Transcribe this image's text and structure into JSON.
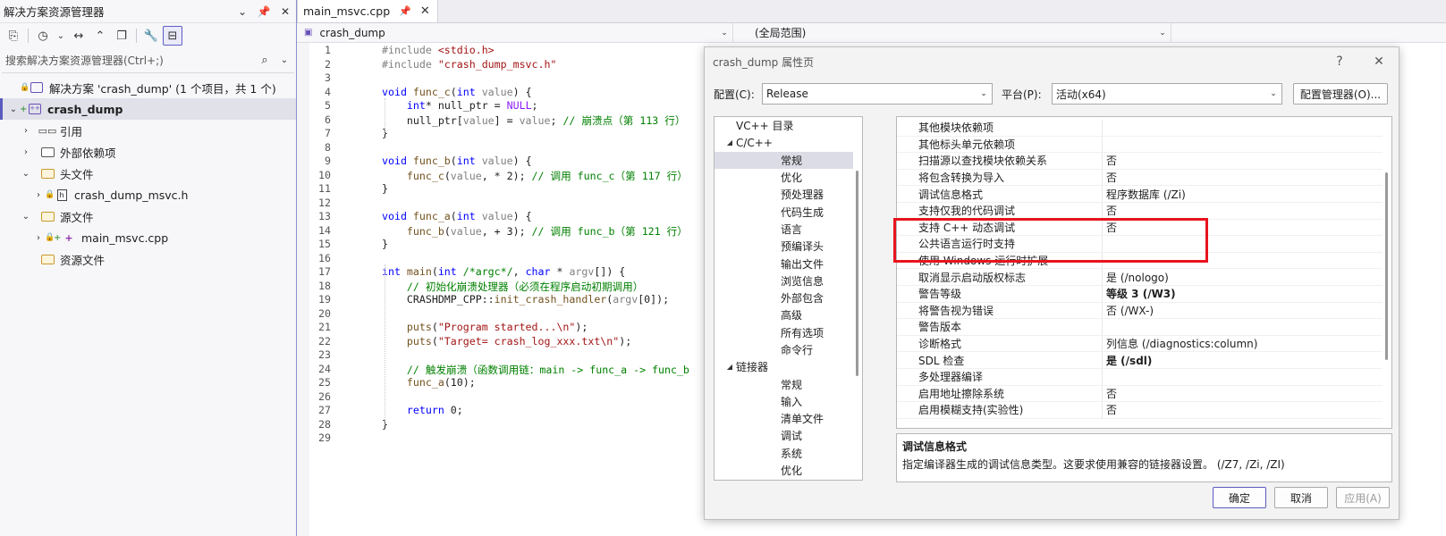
{
  "solution_explorer": {
    "title": "解决方案资源管理器",
    "search_placeholder": "搜索解决方案资源管理器(Ctrl+;)",
    "tree": [
      {
        "label": "解决方案 'crash_dump' (1 个项目，共 1 个)",
        "level": 0,
        "expand": "",
        "lock": true,
        "icon": "solution-icon"
      },
      {
        "label": "crash_dump",
        "level": 0,
        "expand": "open",
        "plus": true,
        "icon": "project-icon",
        "selected": true,
        "bold": true
      },
      {
        "label": "引用",
        "level": 1,
        "expand": "closed",
        "icon": "reference-icon"
      },
      {
        "label": "外部依赖项",
        "level": 1,
        "expand": "closed",
        "icon": "external-deps-icon"
      },
      {
        "label": "头文件",
        "level": 1,
        "expand": "open",
        "icon": "folder-icon"
      },
      {
        "label": "crash_dump_msvc.h",
        "level": 2,
        "expand": "closed",
        "lock": true,
        "icon": "header-file-icon"
      },
      {
        "label": "源文件",
        "level": 1,
        "expand": "open",
        "icon": "folder-icon"
      },
      {
        "label": "main_msvc.cpp",
        "level": 2,
        "expand": "closed",
        "lock": true,
        "plus": true,
        "icon": "cpp-file-icon"
      },
      {
        "label": "资源文件",
        "level": 1,
        "expand": "",
        "icon": "folder-icon"
      }
    ]
  },
  "editor": {
    "tab": "main_msvc.cpp",
    "nav_project": "crash_dump",
    "nav_scope": "(全局范围)",
    "code_lines": [
      [
        [
          "pp",
          "#include "
        ],
        [
          "str",
          "<stdio.h>"
        ]
      ],
      [
        [
          "pp",
          "#include "
        ],
        [
          "str",
          "\"crash_dump_msvc.h\""
        ]
      ],
      [],
      [
        [
          "kw",
          "void "
        ],
        [
          "fn",
          "func_c"
        ],
        [
          "",
          "("
        ],
        [
          "kw",
          "int "
        ],
        [
          "par",
          "value"
        ],
        [
          "",
          ") {"
        ]
      ],
      [
        [
          "",
          "    "
        ],
        [
          "kw",
          "int"
        ],
        [
          "",
          "* null_ptr = "
        ],
        [
          "mac",
          "NULL"
        ],
        [
          "",
          ";"
        ]
      ],
      [
        [
          "",
          "    null_ptr["
        ],
        [
          "par",
          "value"
        ],
        [
          "",
          "] = "
        ],
        [
          "par",
          "value"
        ],
        [
          "",
          "; "
        ],
        [
          "cm",
          "// 崩溃点（第 113 行）"
        ]
      ],
      [
        [
          "",
          "}"
        ]
      ],
      [],
      [
        [
          "kw",
          "void "
        ],
        [
          "fn",
          "func_b"
        ],
        [
          "",
          "("
        ],
        [
          "kw",
          "int "
        ],
        [
          "par",
          "value"
        ],
        [
          "",
          ") {"
        ]
      ],
      [
        [
          "",
          "    "
        ],
        [
          "fn",
          "func_c"
        ],
        [
          "",
          "("
        ],
        [
          "par",
          "value"
        ],
        [
          "",
          ", * 2); "
        ],
        [
          "cm",
          "// 调用 func_c（第 117 行）"
        ]
      ],
      [
        [
          "",
          "}"
        ]
      ],
      [],
      [
        [
          "kw",
          "void "
        ],
        [
          "fn",
          "func_a"
        ],
        [
          "",
          "("
        ],
        [
          "kw",
          "int "
        ],
        [
          "par",
          "value"
        ],
        [
          "",
          ") {"
        ]
      ],
      [
        [
          "",
          "    "
        ],
        [
          "fn",
          "func_b"
        ],
        [
          "",
          "("
        ],
        [
          "par",
          "value"
        ],
        [
          "",
          ", + 3); "
        ],
        [
          "cm",
          "// 调用 func_b（第 121 行）"
        ]
      ],
      [
        [
          "",
          "}"
        ]
      ],
      [],
      [
        [
          "kw",
          "int "
        ],
        [
          "fn",
          "main"
        ],
        [
          "",
          "("
        ],
        [
          "kw",
          "int "
        ],
        [
          "cm",
          "/*argc*/"
        ],
        [
          "",
          ", "
        ],
        [
          "kw",
          "char"
        ],
        [
          "",
          " * "
        ],
        [
          "par",
          "argv"
        ],
        [
          "",
          "[]) {"
        ]
      ],
      [
        [
          "",
          "    "
        ],
        [
          "cm",
          "// 初始化崩溃处理器（必须在程序启动初期调用）"
        ]
      ],
      [
        [
          "",
          "    CRASHDMP_CPP::"
        ],
        [
          "fn",
          "init_crash_handler"
        ],
        [
          "",
          "("
        ],
        [
          "par",
          "argv"
        ],
        [
          "",
          "[0]);"
        ]
      ],
      [],
      [
        [
          "",
          "    "
        ],
        [
          "fn",
          "puts"
        ],
        [
          "",
          "("
        ],
        [
          "str",
          "\"Program started...\\n\""
        ],
        [
          "",
          ");"
        ]
      ],
      [
        [
          "",
          "    "
        ],
        [
          "fn",
          "puts"
        ],
        [
          "",
          "("
        ],
        [
          "str",
          "\"Target= crash_log_xxx.txt\\n\""
        ],
        [
          "",
          ");"
        ]
      ],
      [],
      [
        [
          "",
          "    "
        ],
        [
          "cm",
          "// 触发崩溃（函数调用链：main -> func_a -> func_b"
        ]
      ],
      [
        [
          "",
          "    "
        ],
        [
          "fn",
          "func_a"
        ],
        [
          "",
          "(10);"
        ]
      ],
      [],
      [
        [
          "",
          "    "
        ],
        [
          "kw",
          "return "
        ],
        [
          "",
          "0;"
        ]
      ],
      [
        [
          "",
          "}"
        ]
      ],
      []
    ]
  },
  "dialog": {
    "title": "crash_dump 属性页",
    "help": "?",
    "close": "✕",
    "config_label": "配置(C):",
    "config_value": "Release",
    "platform_label": "平台(P):",
    "platform_value": "活动(x64)",
    "config_manager": "配置管理器(O)...",
    "nav": [
      {
        "label": "VC++ 目录",
        "indent": 1,
        "tri": ""
      },
      {
        "label": "C/C++",
        "indent": 1,
        "tri": "◢"
      },
      {
        "label": "常规",
        "indent": 2,
        "tri": "",
        "selected": true
      },
      {
        "label": "优化",
        "indent": 2,
        "tri": ""
      },
      {
        "label": "预处理器",
        "indent": 2,
        "tri": ""
      },
      {
        "label": "代码生成",
        "indent": 2,
        "tri": ""
      },
      {
        "label": "语言",
        "indent": 2,
        "tri": ""
      },
      {
        "label": "预编译头",
        "indent": 2,
        "tri": ""
      },
      {
        "label": "输出文件",
        "indent": 2,
        "tri": ""
      },
      {
        "label": "浏览信息",
        "indent": 2,
        "tri": ""
      },
      {
        "label": "外部包含",
        "indent": 2,
        "tri": ""
      },
      {
        "label": "高级",
        "indent": 2,
        "tri": ""
      },
      {
        "label": "所有选项",
        "indent": 2,
        "tri": ""
      },
      {
        "label": "命令行",
        "indent": 2,
        "tri": ""
      },
      {
        "label": "链接器",
        "indent": 1,
        "tri": "◢"
      },
      {
        "label": "常规",
        "indent": 2,
        "tri": ""
      },
      {
        "label": "输入",
        "indent": 2,
        "tri": ""
      },
      {
        "label": "清单文件",
        "indent": 2,
        "tri": ""
      },
      {
        "label": "调试",
        "indent": 2,
        "tri": ""
      },
      {
        "label": "系统",
        "indent": 2,
        "tri": ""
      },
      {
        "label": "优化",
        "indent": 2,
        "tri": ""
      }
    ],
    "properties": [
      {
        "name": "其他模块依赖项",
        "value": ""
      },
      {
        "name": "其他标头单元依赖项",
        "value": ""
      },
      {
        "name": "扫描源以查找模块依赖关系",
        "value": "否"
      },
      {
        "name": "将包含转换为导入",
        "value": "否"
      },
      {
        "name": "调试信息格式",
        "value": "程序数据库 (/Zi)"
      },
      {
        "name": "支持仅我的代码调试",
        "value": "否"
      },
      {
        "name": "支持 C++ 动态调试",
        "value": "否"
      },
      {
        "name": "公共语言运行时支持",
        "value": ""
      },
      {
        "name": "使用 Windows 运行时扩展",
        "value": ""
      },
      {
        "name": "取消显示启动版权标志",
        "value": "是 (/nologo)"
      },
      {
        "name": "警告等级",
        "value": "等级 3 (/W3)",
        "bold": true
      },
      {
        "name": "将警告视为错误",
        "value": "否 (/WX-)"
      },
      {
        "name": "警告版本",
        "value": ""
      },
      {
        "name": "诊断格式",
        "value": "列信息 (/diagnostics:column)"
      },
      {
        "name": "SDL 检查",
        "value": "是 (/sdl)",
        "bold": true
      },
      {
        "name": "多处理器编译",
        "value": ""
      },
      {
        "name": "启用地址擦除系统",
        "value": "否"
      },
      {
        "name": "启用模糊支持(实验性)",
        "value": "否"
      }
    ],
    "desc_title": "调试信息格式",
    "desc_body": "指定编译器生成的调试信息类型。这要求使用兼容的链接器设置。  (/Z7, /Zi, /ZI)",
    "ok": "确定",
    "cancel": "取消",
    "apply": "应用(A)"
  }
}
